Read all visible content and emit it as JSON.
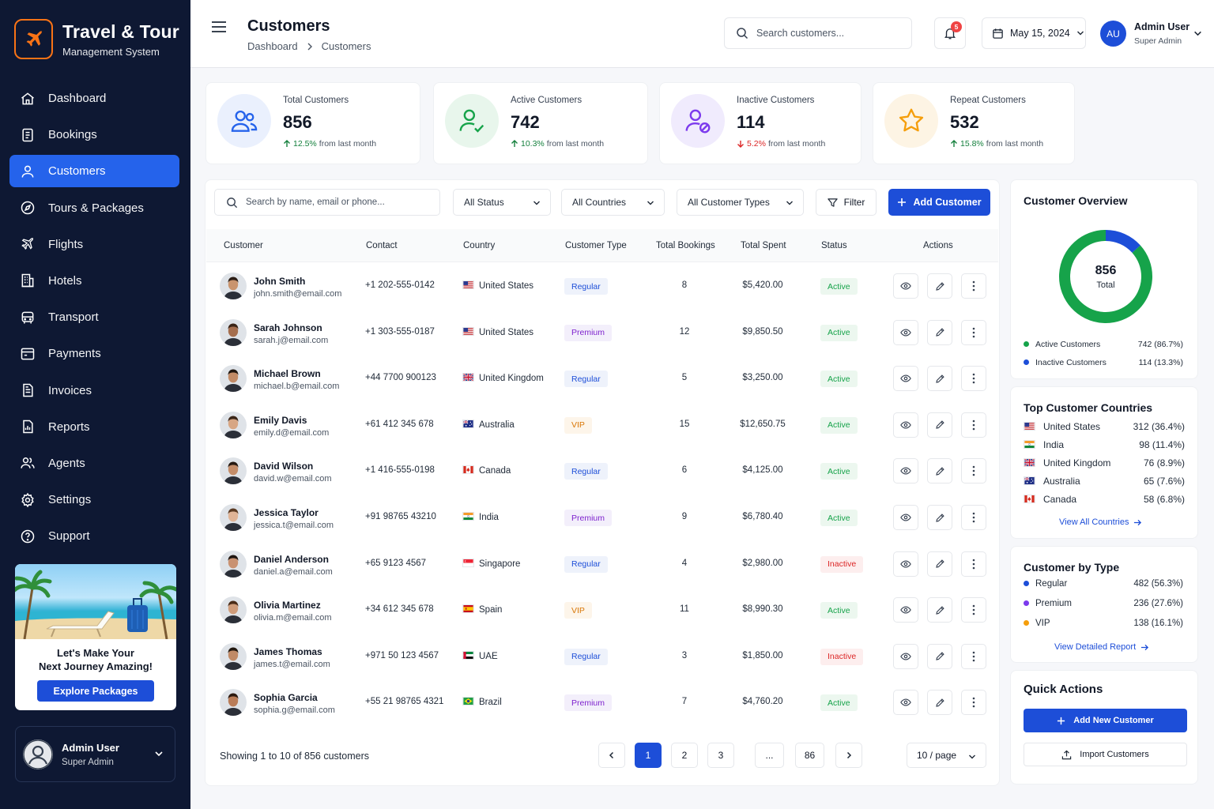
{
  "brand": {
    "title": "Travel & Tour",
    "subtitle": "Management System"
  },
  "nav": [
    {
      "label": "Dashboard",
      "icon": "home-icon"
    },
    {
      "label": "Bookings",
      "icon": "clipboard-icon"
    },
    {
      "label": "Customers",
      "icon": "user-icon",
      "active": true
    },
    {
      "label": "Tours & Packages",
      "icon": "compass-icon"
    },
    {
      "label": "Flights",
      "icon": "plane-icon"
    },
    {
      "label": "Hotels",
      "icon": "building-icon"
    },
    {
      "label": "Transport",
      "icon": "bus-icon"
    },
    {
      "label": "Payments",
      "icon": "payment-icon"
    },
    {
      "label": "Invoices",
      "icon": "invoice-icon"
    },
    {
      "label": "Reports",
      "icon": "report-icon"
    },
    {
      "label": "Agents",
      "icon": "agents-icon"
    },
    {
      "label": "Settings",
      "icon": "gear-icon"
    },
    {
      "label": "Support",
      "icon": "help-icon"
    }
  ],
  "promo": {
    "line1": "Let's Make Your",
    "line2": "Next Journey Amazing!",
    "button": "Explore Packages"
  },
  "sidebar_user": {
    "name": "Admin User",
    "role": "Super Admin"
  },
  "header": {
    "title": "Customers",
    "breadcrumb": [
      "Dashboard",
      "Customers"
    ],
    "search_placeholder": "Search customers...",
    "notifications": "5",
    "date": "May 15, 2024",
    "user": {
      "initials": "AU",
      "name": "Admin User",
      "role": "Super Admin"
    }
  },
  "stats": [
    {
      "label": "Total Customers",
      "value": "856",
      "delta": "12.5%",
      "direction": "up",
      "suffix": "from last month",
      "icon": "users-icon",
      "color": "#2563eb",
      "bg": "#eaf0fd"
    },
    {
      "label": "Active Customers",
      "value": "742",
      "delta": "10.3%",
      "direction": "up",
      "suffix": "from last month",
      "icon": "user-check-icon",
      "color": "#16a34a",
      "bg": "#e8f6ec"
    },
    {
      "label": "Inactive Customers",
      "value": "114",
      "delta": "5.2%",
      "direction": "down",
      "suffix": "from last month",
      "icon": "user-blocked-icon",
      "color": "#7c3aed",
      "bg": "#f0ebfd"
    },
    {
      "label": "Repeat Customers",
      "value": "532",
      "delta": "15.8%",
      "direction": "up",
      "suffix": "from last month",
      "icon": "star-icon",
      "color": "#f59e0b",
      "bg": "#fdf4e4"
    }
  ],
  "toolbar": {
    "search_placeholder": "Search by name, email or phone...",
    "status": "All Status",
    "countries": "All Countries",
    "types": "All Customer Types",
    "filter": "Filter",
    "add": "Add Customer"
  },
  "table": {
    "columns": [
      "Customer",
      "Contact",
      "Country",
      "Customer Type",
      "Total Bookings",
      "Total Spent",
      "Status",
      "Actions"
    ],
    "rows": [
      {
        "name": "John Smith",
        "email": "john.smith@email.com",
        "phone": "+1 202-555-0142",
        "country": "United States",
        "flag": "us",
        "type": "Regular",
        "bookings": "8",
        "spent": "$5,420.00",
        "status": "Active",
        "skin": "#c9946e",
        "hair": "#2b1d14"
      },
      {
        "name": "Sarah Johnson",
        "email": "sarah.j@email.com",
        "phone": "+1 303-555-0187",
        "country": "United States",
        "flag": "us",
        "type": "Premium",
        "bookings": "12",
        "spent": "$9,850.50",
        "status": "Active",
        "skin": "#a56e4e",
        "hair": "#3a2416"
      },
      {
        "name": "Michael Brown",
        "email": "michael.b@email.com",
        "phone": "+44 7700 900123",
        "country": "United Kingdom",
        "flag": "uk",
        "type": "Regular",
        "bookings": "5",
        "spent": "$3,250.00",
        "status": "Active",
        "skin": "#c28b66",
        "hair": "#1f160f"
      },
      {
        "name": "Emily Davis",
        "email": "emily.d@email.com",
        "phone": "+61 412 345 678",
        "country": "Australia",
        "flag": "au",
        "type": "VIP",
        "bookings": "15",
        "spent": "$12,650.75",
        "status": "Active",
        "skin": "#d7a684",
        "hair": "#3b2618"
      },
      {
        "name": "David Wilson",
        "email": "david.w@email.com",
        "phone": "+1 416-555-0198",
        "country": "Canada",
        "flag": "ca",
        "type": "Regular",
        "bookings": "6",
        "spent": "$4,125.00",
        "status": "Active",
        "skin": "#c48d69",
        "hair": "#261a12"
      },
      {
        "name": "Jessica Taylor",
        "email": "jessica.t@email.com",
        "phone": "+91 98765 43210",
        "country": "India",
        "flag": "in",
        "type": "Premium",
        "bookings": "9",
        "spent": "$6,780.40",
        "status": "Active",
        "skin": "#e0b496",
        "hair": "#5a3a22"
      },
      {
        "name": "Daniel Anderson",
        "email": "daniel.a@email.com",
        "phone": "+65 9123 4567",
        "country": "Singapore",
        "flag": "sg",
        "type": "Regular",
        "bookings": "4",
        "spent": "$2,980.00",
        "status": "Inactive",
        "skin": "#c99272",
        "hair": "#1e1510"
      },
      {
        "name": "Olivia Martinez",
        "email": "olivia.m@email.com",
        "phone": "+34 612 345 678",
        "country": "Spain",
        "flag": "es",
        "type": "VIP",
        "bookings": "11",
        "spent": "$8,990.30",
        "status": "Active",
        "skin": "#cf9c7a",
        "hair": "#4a2c18"
      },
      {
        "name": "James Thomas",
        "email": "james.t@email.com",
        "phone": "+971 50 123 4567",
        "country": "UAE",
        "flag": "ae",
        "type": "Regular",
        "bookings": "3",
        "spent": "$1,850.00",
        "status": "Inactive",
        "skin": "#c08a66",
        "hair": "#22180f"
      },
      {
        "name": "Sophia Garcia",
        "email": "sophia.g@email.com",
        "phone": "+55 21 98765 4321",
        "country": "Brazil",
        "flag": "br",
        "type": "Premium",
        "bookings": "7",
        "spent": "$4,760.20",
        "status": "Active",
        "skin": "#b97c58",
        "hair": "#2c1a10"
      }
    ]
  },
  "pagination": {
    "showing": "Showing 1 to 10 of 856 customers",
    "pages": [
      "1",
      "2",
      "3",
      "...",
      "86"
    ],
    "current": "1",
    "per_page": "10 / page"
  },
  "overview": {
    "title": "Customer Overview",
    "total": "856",
    "total_label": "Total",
    "segments": [
      {
        "label": "Active Customers",
        "value": 742,
        "display": "742 (86.7%)",
        "color": "#16a34a"
      },
      {
        "label": "Inactive Customers",
        "value": 114,
        "display": "114 (13.3%)",
        "color": "#1d4ed8"
      }
    ]
  },
  "countries_card": {
    "title": "Top Customer Countries",
    "items": [
      {
        "name": "United States",
        "flag": "us",
        "value": "312 (36.4%)"
      },
      {
        "name": "India",
        "flag": "in",
        "value": "98 (11.4%)"
      },
      {
        "name": "United Kingdom",
        "flag": "uk",
        "value": "76 (8.9%)"
      },
      {
        "name": "Australia",
        "flag": "au",
        "value": "65 (7.6%)"
      },
      {
        "name": "Canada",
        "flag": "ca",
        "value": "58 (6.8%)"
      }
    ],
    "link": "View All Countries"
  },
  "types_card": {
    "title": "Customer by Type",
    "items": [
      {
        "name": "Regular",
        "value": "482 (56.3%)",
        "color": "#1d4ed8"
      },
      {
        "name": "Premium",
        "value": "236 (27.6%)",
        "color": "#7c3aed"
      },
      {
        "name": "VIP",
        "value": "138 (16.1%)",
        "color": "#f59e0b"
      }
    ],
    "link": "View Detailed Report"
  },
  "quick_actions": {
    "title": "Quick Actions",
    "add": "Add New Customer",
    "import": "Import Customers"
  }
}
